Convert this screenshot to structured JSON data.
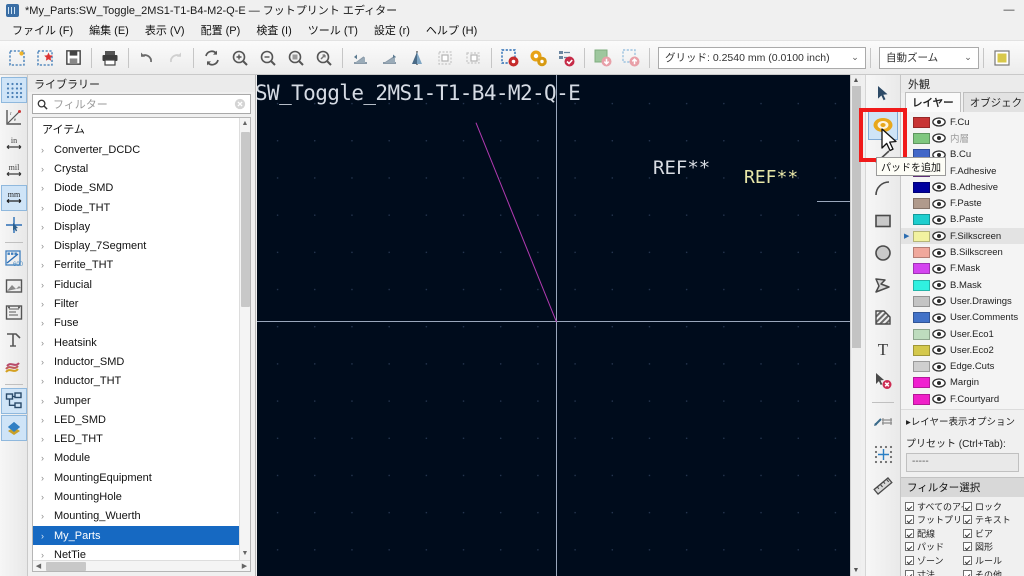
{
  "window": {
    "title": "*My_Parts:SW_Toggle_2MS1-T1-B4-M2-Q-E — フットプリント エディター",
    "icon": "kicad-footprint-editor-icon",
    "minimize": "—",
    "maximize": "□",
    "close": "✕"
  },
  "menu": {
    "items": [
      {
        "label": "ファイル (F)",
        "name": "menu-file"
      },
      {
        "label": "編集 (E)",
        "name": "menu-edit"
      },
      {
        "label": "表示 (V)",
        "name": "menu-view"
      },
      {
        "label": "配置 (P)",
        "name": "menu-place"
      },
      {
        "label": "検査 (I)",
        "name": "menu-inspect"
      },
      {
        "label": "ツール (T)",
        "name": "menu-tools"
      },
      {
        "label": "設定 (r)",
        "name": "menu-preferences"
      },
      {
        "label": "ヘルプ (H)",
        "name": "menu-help"
      }
    ]
  },
  "toolbar": {
    "buttons": [
      {
        "name": "new-footprint-icon"
      },
      {
        "name": "new-footprint-from-wizard-icon"
      },
      {
        "name": "save-icon"
      },
      {
        "name": "print-icon"
      },
      {
        "name": "undo-icon"
      },
      {
        "name": "redo-icon"
      },
      {
        "name": "refresh-icon"
      },
      {
        "name": "zoom-in-icon"
      },
      {
        "name": "zoom-out-icon"
      },
      {
        "name": "zoom-fit-icon"
      },
      {
        "name": "zoom-area-icon"
      },
      {
        "name": "rotate-ccw-icon"
      },
      {
        "name": "rotate-cw-icon"
      },
      {
        "name": "mirror-icon"
      },
      {
        "name": "footprint-properties-icon"
      },
      {
        "name": "default-pad-properties-icon"
      },
      {
        "name": "pad-settings-icon"
      },
      {
        "name": "footprint-checker-icon"
      },
      {
        "name": "check-footprint-icon"
      },
      {
        "name": "load-footprint-from-board-icon"
      },
      {
        "name": "insert-footprint-to-board-icon"
      }
    ],
    "grid_label": "グリッド: 0.2540 mm (0.0100 inch)",
    "zoom_label": "自動ズーム",
    "dropdown_arrow": "⌄"
  },
  "left_toolbar": {
    "buttons": [
      {
        "name": "toggle-grid-icon",
        "glyph": "",
        "selected": true
      },
      {
        "name": "polar-coordinates-icon",
        "glyph": ""
      },
      {
        "name": "units-inches-icon",
        "glyph": "in"
      },
      {
        "name": "units-mils-icon",
        "glyph": "mil"
      },
      {
        "name": "units-mm-icon",
        "glyph": "mm",
        "selected": true
      },
      {
        "name": "toggle-cursor-icon",
        "glyph": ""
      },
      {
        "name": "show-pads-sketch-icon",
        "glyph": ""
      },
      {
        "name": "show-graphics-sketch-icon",
        "glyph": ""
      },
      {
        "name": "show-text-sketch-icon",
        "glyph": ""
      },
      {
        "name": "show-pad-clearance-icon",
        "glyph": ""
      },
      {
        "name": "high-contrast-mode-icon",
        "glyph": ""
      },
      {
        "name": "toggle-tree-panel-icon",
        "glyph": "",
        "selected": true
      },
      {
        "name": "toggle-appearance-panel-icon",
        "glyph": "",
        "selected": true
      }
    ]
  },
  "library": {
    "header": "ライブラリー",
    "filter_placeholder": "フィルター",
    "filter_value": "",
    "search_icon": "search-icon",
    "clear_icon": "clear-icon",
    "column_header": "アイテム",
    "items": [
      {
        "label": "Converter_DCDC",
        "selected": false
      },
      {
        "label": "Crystal",
        "selected": false
      },
      {
        "label": "Diode_SMD",
        "selected": false
      },
      {
        "label": "Diode_THT",
        "selected": false
      },
      {
        "label": "Display",
        "selected": false
      },
      {
        "label": "Display_7Segment",
        "selected": false
      },
      {
        "label": "Ferrite_THT",
        "selected": false
      },
      {
        "label": "Fiducial",
        "selected": false
      },
      {
        "label": "Filter",
        "selected": false
      },
      {
        "label": "Fuse",
        "selected": false
      },
      {
        "label": "Heatsink",
        "selected": false
      },
      {
        "label": "Inductor_SMD",
        "selected": false
      },
      {
        "label": "Inductor_THT",
        "selected": false
      },
      {
        "label": "Jumper",
        "selected": false
      },
      {
        "label": "LED_SMD",
        "selected": false
      },
      {
        "label": "LED_THT",
        "selected": false
      },
      {
        "label": "Module",
        "selected": false
      },
      {
        "label": "MountingEquipment",
        "selected": false
      },
      {
        "label": "MountingHole",
        "selected": false
      },
      {
        "label": "Mounting_Wuerth",
        "selected": false
      },
      {
        "label": "My_Parts",
        "selected": true
      },
      {
        "label": "NetTie",
        "selected": false
      }
    ],
    "expander_glyph": "›"
  },
  "canvas": {
    "footprint_name": "SW_Toggle_2MS1-T1-B4-M2-Q-E",
    "reference_value": "REF**",
    "reference_value_2": "REF**",
    "background_color": "#000c1c",
    "crosshair_color": "#9aa7bb",
    "silkscreen_color": "#b13ab1"
  },
  "right_toolbar": {
    "buttons": [
      {
        "name": "select-tool-icon",
        "selected": false
      },
      {
        "name": "add-pad-icon",
        "selected": true,
        "highlighted": true
      },
      {
        "name": "draw-line-icon"
      },
      {
        "name": "draw-arc-icon"
      },
      {
        "name": "draw-rectangle-icon"
      },
      {
        "name": "draw-circle-icon"
      },
      {
        "name": "draw-polygon-icon"
      },
      {
        "name": "add-zone-icon"
      },
      {
        "name": "add-text-icon"
      },
      {
        "name": "delete-tool-icon"
      },
      {
        "name": "add-dimension-icon"
      },
      {
        "name": "set-grid-origin-icon"
      },
      {
        "name": "measure-tool-icon"
      }
    ],
    "tooltip": "パッドを追加",
    "highlight_color": "#f01a1a"
  },
  "appearance": {
    "title": "外観",
    "tabs": [
      {
        "label": "レイヤー",
        "active": true,
        "name": "tab-layers"
      },
      {
        "label": "オブジェクト",
        "active": false,
        "name": "tab-objects"
      }
    ],
    "layers": [
      {
        "label": "F.Cu",
        "color": "#c83434",
        "dim": false,
        "expandable": false
      },
      {
        "label": "内層",
        "color": "#7fc77f",
        "dim": true,
        "expandable": false
      },
      {
        "label": "B.Cu",
        "color": "#4268c8",
        "dim": false,
        "expandable": false
      },
      {
        "label": "F.Adhesive",
        "color": "#7f3f9e",
        "dim": false,
        "expandable": false
      },
      {
        "label": "B.Adhesive",
        "color": "#00009e",
        "dim": false,
        "expandable": false
      },
      {
        "label": "F.Paste",
        "color": "#b09a8c",
        "dim": false,
        "expandable": false
      },
      {
        "label": "B.Paste",
        "color": "#1ecece",
        "dim": false,
        "expandable": false
      },
      {
        "label": "F.Silkscreen",
        "color": "#f2f2a0",
        "dim": false,
        "expandable": true
      },
      {
        "label": "B.Silkscreen",
        "color": "#f0a89c",
        "dim": false,
        "expandable": false
      },
      {
        "label": "F.Mask",
        "color": "#d444f0",
        "dim": false,
        "expandable": false
      },
      {
        "label": "B.Mask",
        "color": "#30f0e0",
        "dim": false,
        "expandable": false
      },
      {
        "label": "User.Drawings",
        "color": "#c4c4c4",
        "dim": false,
        "expandable": false
      },
      {
        "label": "User.Comments",
        "color": "#4272c8",
        "dim": false,
        "expandable": false
      },
      {
        "label": "User.Eco1",
        "color": "#bedcbe",
        "dim": false,
        "expandable": false
      },
      {
        "label": "User.Eco2",
        "color": "#d4c84c",
        "dim": false,
        "expandable": false
      },
      {
        "label": "Edge.Cuts",
        "color": "#cfcfcf",
        "dim": false,
        "expandable": false
      },
      {
        "label": "Margin",
        "color": "#f020d0",
        "dim": false,
        "expandable": false
      },
      {
        "label": "F.Courtyard",
        "color": "#f020c8",
        "dim": false,
        "expandable": false
      }
    ],
    "layer_display_options": "レイヤー表示オプション",
    "expander_glyph": "▸",
    "preset_label": "プリセット (Ctrl+Tab):",
    "preset_value": "-----",
    "filter_title": "フィルター選択",
    "filter_left": [
      {
        "label": "すべてのアイテム",
        "checked": true
      },
      {
        "label": "フットプリント",
        "checked": true
      },
      {
        "label": "配線",
        "checked": true
      },
      {
        "label": "パッド",
        "checked": true
      },
      {
        "label": "ゾーン",
        "checked": true
      },
      {
        "label": "寸法",
        "checked": true
      }
    ],
    "filter_right": [
      {
        "label": "ロック",
        "checked": true
      },
      {
        "label": "テキスト",
        "checked": true
      },
      {
        "label": "ビア",
        "checked": true
      },
      {
        "label": "図形",
        "checked": true
      },
      {
        "label": "ルール",
        "checked": true
      },
      {
        "label": "その他",
        "checked": true
      }
    ]
  }
}
